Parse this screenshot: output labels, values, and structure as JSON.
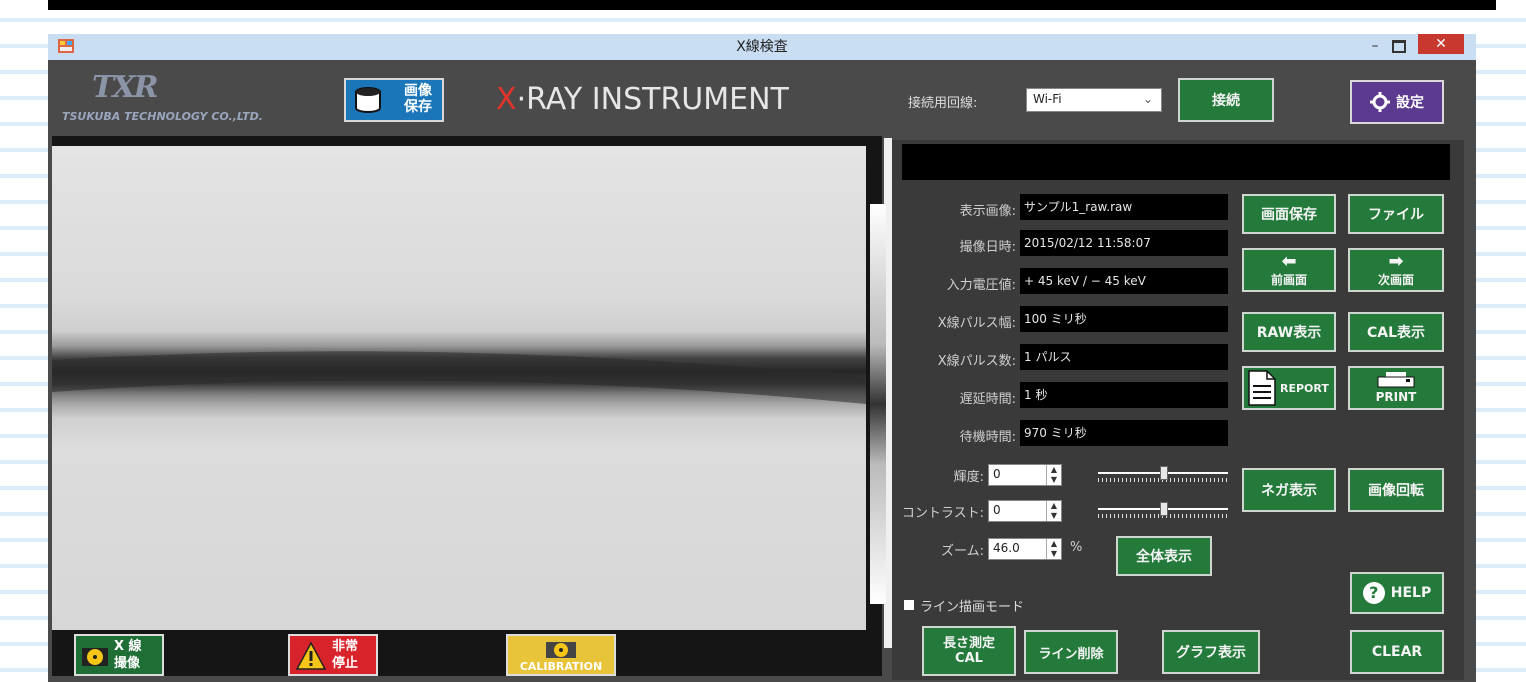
{
  "window": {
    "title": "X線検査"
  },
  "logo": {
    "mark": "TXR",
    "company": "TSUKUBA TECHNOLOGY CO.,LTD."
  },
  "header": {
    "save_image_line1": "画像",
    "save_image_line2": "保存",
    "brand_x": "X",
    "brand_rest": "·RAY INSTRUMENT",
    "connection_label": "接続用回線:",
    "connection_value": "Wi-Fi",
    "connect_button": "接続",
    "settings_button": "設定"
  },
  "info": {
    "rows": [
      {
        "label": "表示画像:",
        "value": "サンプル1_raw.raw"
      },
      {
        "label": "撮像日時:",
        "value": "2015/02/12 11:58:07"
      },
      {
        "label": "入力電圧値:",
        "value": "+ 45 keV / − 45 keV"
      },
      {
        "label": "X線パルス幅:",
        "value": "100 ミリ秒"
      },
      {
        "label": "X線パルス数:",
        "value": "1 パルス"
      },
      {
        "label": "遅延時間:",
        "value": "1 秒"
      },
      {
        "label": "待機時間:",
        "value": "970 ミリ秒"
      }
    ]
  },
  "controls": {
    "brightness_label": "輝度:",
    "brightness_value": "0",
    "brightness_level": 0.5,
    "contrast_label": "コントラスト:",
    "contrast_value": "0",
    "contrast_level": 0.5,
    "zoom_label": "ズーム:",
    "zoom_value": "46.0",
    "zoom_unit": "%",
    "fit_button": "全体表示",
    "line_mode_label": "ライン描画モード"
  },
  "buttons": {
    "screen_save": "画面保存",
    "file": "ファイル",
    "prev": "前画面",
    "next": "次画面",
    "raw": "RAW表示",
    "cal": "CAL表示",
    "report": "REPORT",
    "print": "PRINT",
    "negative": "ネガ表示",
    "rotate": "画像回転",
    "help": "HELP",
    "clear": "CLEAR",
    "measure_line1": "長さ測定",
    "measure_line2": "CAL",
    "delete_line": "ライン削除",
    "graph": "グラフ表示"
  },
  "bottom": {
    "xray_line1": "X 線",
    "xray_line2": "撮像",
    "stop_line1": "非常",
    "stop_line2": "停止",
    "calibration": "CALIBRATION"
  },
  "colors": {
    "window_bg": "#4a4a4a",
    "green_button": "#247a3b",
    "blue_button": "#1a76b9",
    "purple_button": "#5b3a8f",
    "brand_accent": "#e2342b"
  }
}
